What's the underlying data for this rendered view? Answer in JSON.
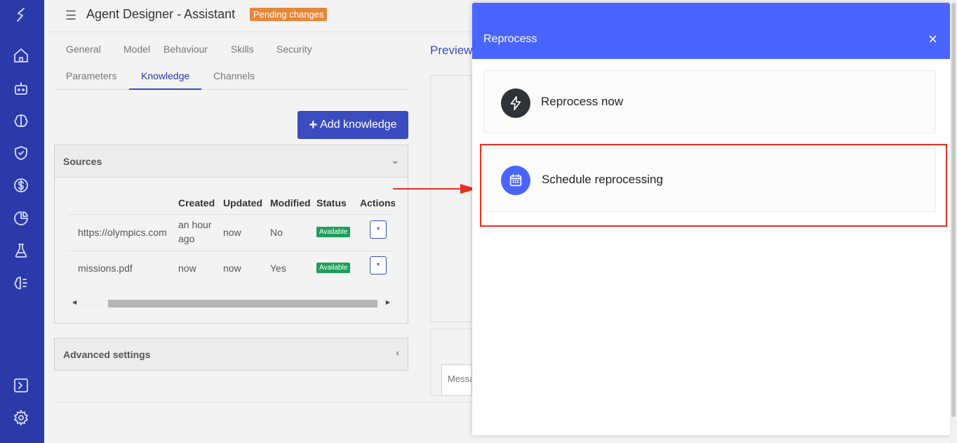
{
  "sidebar": {
    "icons": [
      "logo-icon",
      "home-icon",
      "robot-icon",
      "brain-icon",
      "shield-icon",
      "dollar-icon",
      "pie-chart-icon",
      "flask-icon",
      "neural-icon",
      "terminal-icon",
      "gear-icon"
    ]
  },
  "header": {
    "title": "Agent Designer - Assistant",
    "badge": "Pending changes"
  },
  "tabs": {
    "row1": [
      "General",
      "Model",
      "Behaviour",
      "Skills",
      "Security"
    ],
    "row2": [
      "Parameters",
      "Knowledge",
      "Channels"
    ],
    "active": "Knowledge"
  },
  "toolbar": {
    "add_label": "Add knowledge"
  },
  "sources": {
    "title": "Sources",
    "columns": [
      "Created",
      "Updated",
      "Modified",
      "Status",
      "Actions"
    ],
    "rows": [
      {
        "name": "https://olympics.com",
        "created": "an hour ago",
        "updated": "now",
        "modified": "No",
        "status": "Available"
      },
      {
        "name": "missions.pdf",
        "created": "now",
        "updated": "now",
        "modified": "Yes",
        "status": "Available"
      }
    ]
  },
  "advanced": {
    "title": "Advanced settings"
  },
  "preview": {
    "label": "Preview",
    "message_placeholder": "Messa"
  },
  "modal": {
    "title": "Reprocess",
    "close": "×",
    "options": [
      {
        "label": "Reprocess now",
        "icon": "lightning-icon",
        "icon_bg": "#2f3337"
      },
      {
        "label": "Schedule reprocessing",
        "icon": "calendar-icon",
        "icon_bg": "#4a64ff"
      }
    ]
  },
  "colors": {
    "sidebar": "#2b3aa8",
    "accent": "#3b4cc0",
    "modal_header": "#4a64ff",
    "badge": "#e5883a",
    "status": "#1e9e5a",
    "highlight": "#e8301f"
  }
}
